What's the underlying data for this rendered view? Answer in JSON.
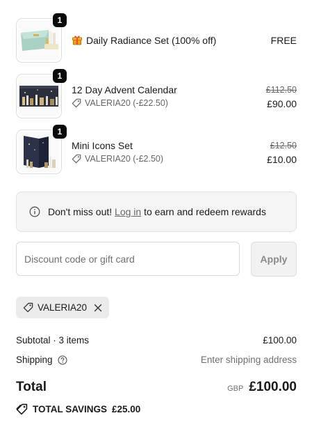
{
  "line_items": [
    {
      "title": "Daily Radiance Set (100% off)",
      "quantity": "1",
      "has_gift_icon": true,
      "discount": "",
      "price_original": "",
      "price_current": "FREE"
    },
    {
      "title": "12 Day Advent Calendar",
      "quantity": "1",
      "has_gift_icon": false,
      "discount": "VALERIA20 (-£22.50)",
      "price_original": "£112.50",
      "price_current": "£90.00"
    },
    {
      "title": "Mini Icons Set",
      "quantity": "1",
      "has_gift_icon": false,
      "discount": "VALERIA20 (-£2.50)",
      "price_original": "£12.50",
      "price_current": "£10.00"
    }
  ],
  "rewards_notice": {
    "prefix": "Don't miss out! ",
    "link": "Log in",
    "suffix": " to earn and redeem rewards"
  },
  "discount_form": {
    "placeholder": "Discount code or gift card",
    "value": "",
    "apply_label": "Apply"
  },
  "applied_code": "VALERIA20",
  "summary": {
    "subtotal_label": "Subtotal · 3 items",
    "subtotal_value": "£100.00",
    "shipping_label": "Shipping",
    "shipping_value": "Enter shipping address",
    "total_label": "Total",
    "currency": "GBP",
    "total_value": "£100.00",
    "savings_label": "TOTAL SAVINGS",
    "savings_value": "£25.00"
  },
  "colors": {
    "text": "#1a1a1a",
    "muted": "#707070",
    "badge": "#0a0a0a",
    "notice_bg": "#f5f5f5",
    "chip_bg": "#ebebeb",
    "gift": "#f0a020"
  },
  "icons": [
    "gift-icon",
    "tag-icon",
    "info-icon",
    "help-icon",
    "close-icon"
  ]
}
